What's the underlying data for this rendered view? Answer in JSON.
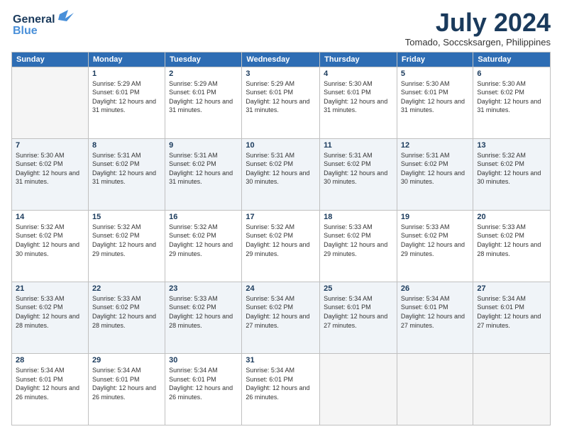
{
  "logo": {
    "line1": "General",
    "line2": "Blue",
    "bird": "🐦"
  },
  "title": "July 2024",
  "location": "Tomado, Soccsksargen, Philippines",
  "days_of_week": [
    "Sunday",
    "Monday",
    "Tuesday",
    "Wednesday",
    "Thursday",
    "Friday",
    "Saturday"
  ],
  "weeks": [
    [
      {
        "day": "",
        "sunrise": "",
        "sunset": "",
        "daylight": ""
      },
      {
        "day": "1",
        "sunrise": "Sunrise: 5:29 AM",
        "sunset": "Sunset: 6:01 PM",
        "daylight": "Daylight: 12 hours and 31 minutes."
      },
      {
        "day": "2",
        "sunrise": "Sunrise: 5:29 AM",
        "sunset": "Sunset: 6:01 PM",
        "daylight": "Daylight: 12 hours and 31 minutes."
      },
      {
        "day": "3",
        "sunrise": "Sunrise: 5:29 AM",
        "sunset": "Sunset: 6:01 PM",
        "daylight": "Daylight: 12 hours and 31 minutes."
      },
      {
        "day": "4",
        "sunrise": "Sunrise: 5:30 AM",
        "sunset": "Sunset: 6:01 PM",
        "daylight": "Daylight: 12 hours and 31 minutes."
      },
      {
        "day": "5",
        "sunrise": "Sunrise: 5:30 AM",
        "sunset": "Sunset: 6:01 PM",
        "daylight": "Daylight: 12 hours and 31 minutes."
      },
      {
        "day": "6",
        "sunrise": "Sunrise: 5:30 AM",
        "sunset": "Sunset: 6:02 PM",
        "daylight": "Daylight: 12 hours and 31 minutes."
      }
    ],
    [
      {
        "day": "7",
        "sunrise": "Sunrise: 5:30 AM",
        "sunset": "Sunset: 6:02 PM",
        "daylight": "Daylight: 12 hours and 31 minutes."
      },
      {
        "day": "8",
        "sunrise": "Sunrise: 5:31 AM",
        "sunset": "Sunset: 6:02 PM",
        "daylight": "Daylight: 12 hours and 31 minutes."
      },
      {
        "day": "9",
        "sunrise": "Sunrise: 5:31 AM",
        "sunset": "Sunset: 6:02 PM",
        "daylight": "Daylight: 12 hours and 31 minutes."
      },
      {
        "day": "10",
        "sunrise": "Sunrise: 5:31 AM",
        "sunset": "Sunset: 6:02 PM",
        "daylight": "Daylight: 12 hours and 30 minutes."
      },
      {
        "day": "11",
        "sunrise": "Sunrise: 5:31 AM",
        "sunset": "Sunset: 6:02 PM",
        "daylight": "Daylight: 12 hours and 30 minutes."
      },
      {
        "day": "12",
        "sunrise": "Sunrise: 5:31 AM",
        "sunset": "Sunset: 6:02 PM",
        "daylight": "Daylight: 12 hours and 30 minutes."
      },
      {
        "day": "13",
        "sunrise": "Sunrise: 5:32 AM",
        "sunset": "Sunset: 6:02 PM",
        "daylight": "Daylight: 12 hours and 30 minutes."
      }
    ],
    [
      {
        "day": "14",
        "sunrise": "Sunrise: 5:32 AM",
        "sunset": "Sunset: 6:02 PM",
        "daylight": "Daylight: 12 hours and 30 minutes."
      },
      {
        "day": "15",
        "sunrise": "Sunrise: 5:32 AM",
        "sunset": "Sunset: 6:02 PM",
        "daylight": "Daylight: 12 hours and 29 minutes."
      },
      {
        "day": "16",
        "sunrise": "Sunrise: 5:32 AM",
        "sunset": "Sunset: 6:02 PM",
        "daylight": "Daylight: 12 hours and 29 minutes."
      },
      {
        "day": "17",
        "sunrise": "Sunrise: 5:32 AM",
        "sunset": "Sunset: 6:02 PM",
        "daylight": "Daylight: 12 hours and 29 minutes."
      },
      {
        "day": "18",
        "sunrise": "Sunrise: 5:33 AM",
        "sunset": "Sunset: 6:02 PM",
        "daylight": "Daylight: 12 hours and 29 minutes."
      },
      {
        "day": "19",
        "sunrise": "Sunrise: 5:33 AM",
        "sunset": "Sunset: 6:02 PM",
        "daylight": "Daylight: 12 hours and 29 minutes."
      },
      {
        "day": "20",
        "sunrise": "Sunrise: 5:33 AM",
        "sunset": "Sunset: 6:02 PM",
        "daylight": "Daylight: 12 hours and 28 minutes."
      }
    ],
    [
      {
        "day": "21",
        "sunrise": "Sunrise: 5:33 AM",
        "sunset": "Sunset: 6:02 PM",
        "daylight": "Daylight: 12 hours and 28 minutes."
      },
      {
        "day": "22",
        "sunrise": "Sunrise: 5:33 AM",
        "sunset": "Sunset: 6:02 PM",
        "daylight": "Daylight: 12 hours and 28 minutes."
      },
      {
        "day": "23",
        "sunrise": "Sunrise: 5:33 AM",
        "sunset": "Sunset: 6:02 PM",
        "daylight": "Daylight: 12 hours and 28 minutes."
      },
      {
        "day": "24",
        "sunrise": "Sunrise: 5:34 AM",
        "sunset": "Sunset: 6:02 PM",
        "daylight": "Daylight: 12 hours and 27 minutes."
      },
      {
        "day": "25",
        "sunrise": "Sunrise: 5:34 AM",
        "sunset": "Sunset: 6:01 PM",
        "daylight": "Daylight: 12 hours and 27 minutes."
      },
      {
        "day": "26",
        "sunrise": "Sunrise: 5:34 AM",
        "sunset": "Sunset: 6:01 PM",
        "daylight": "Daylight: 12 hours and 27 minutes."
      },
      {
        "day": "27",
        "sunrise": "Sunrise: 5:34 AM",
        "sunset": "Sunset: 6:01 PM",
        "daylight": "Daylight: 12 hours and 27 minutes."
      }
    ],
    [
      {
        "day": "28",
        "sunrise": "Sunrise: 5:34 AM",
        "sunset": "Sunset: 6:01 PM",
        "daylight": "Daylight: 12 hours and 26 minutes."
      },
      {
        "day": "29",
        "sunrise": "Sunrise: 5:34 AM",
        "sunset": "Sunset: 6:01 PM",
        "daylight": "Daylight: 12 hours and 26 minutes."
      },
      {
        "day": "30",
        "sunrise": "Sunrise: 5:34 AM",
        "sunset": "Sunset: 6:01 PM",
        "daylight": "Daylight: 12 hours and 26 minutes."
      },
      {
        "day": "31",
        "sunrise": "Sunrise: 5:34 AM",
        "sunset": "Sunset: 6:01 PM",
        "daylight": "Daylight: 12 hours and 26 minutes."
      },
      {
        "day": "",
        "sunrise": "",
        "sunset": "",
        "daylight": ""
      },
      {
        "day": "",
        "sunrise": "",
        "sunset": "",
        "daylight": ""
      },
      {
        "day": "",
        "sunrise": "",
        "sunset": "",
        "daylight": ""
      }
    ]
  ]
}
